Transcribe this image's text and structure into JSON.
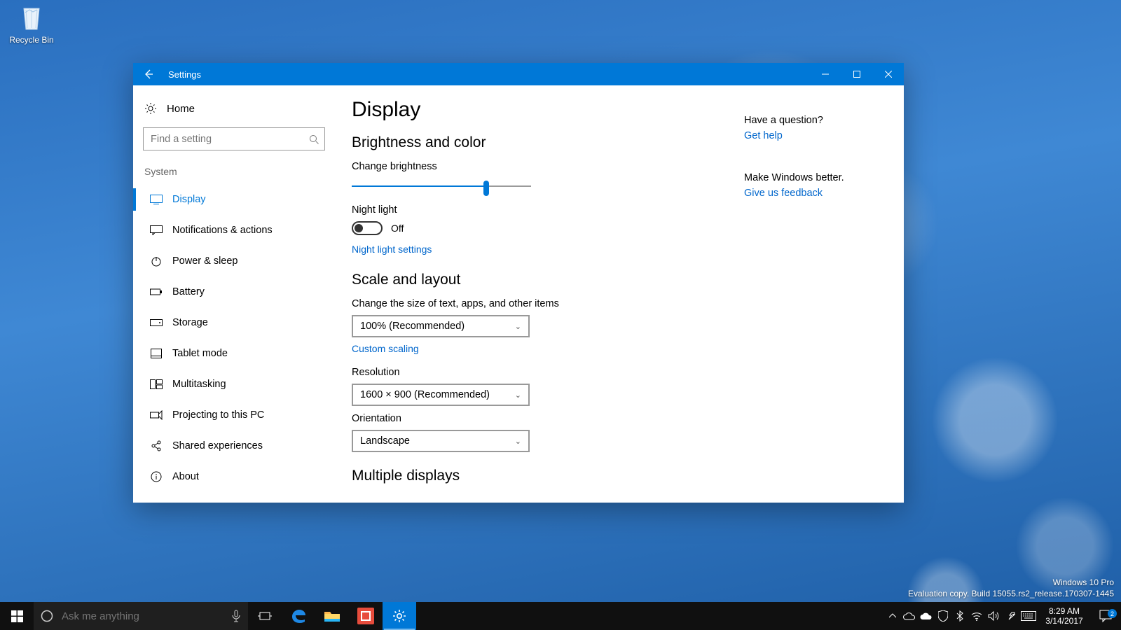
{
  "desktop": {
    "recycle_bin": "Recycle Bin",
    "watermark_line1": "Windows 10 Pro",
    "watermark_line2": "Evaluation copy. Build 15055.rs2_release.170307-1445"
  },
  "settings": {
    "title": "Settings",
    "home": "Home",
    "search_placeholder": "Find a setting",
    "group": "System",
    "nav": {
      "display": "Display",
      "notifications": "Notifications & actions",
      "power": "Power & sleep",
      "battery": "Battery",
      "storage": "Storage",
      "tablet": "Tablet mode",
      "multitask": "Multitasking",
      "projecting": "Projecting to this PC",
      "shared": "Shared experiences",
      "about": "About"
    },
    "page_title": "Display",
    "sect_brightness": "Brightness and color",
    "brightness_label": "Change brightness",
    "brightness_percent": 75,
    "night_light_label": "Night light",
    "night_light_state": "Off",
    "night_light_settings": "Night light settings",
    "sect_scale": "Scale and layout",
    "scale_label": "Change the size of text, apps, and other items",
    "scale_value": "100% (Recommended)",
    "custom_scaling": "Custom scaling",
    "resolution_label": "Resolution",
    "resolution_value": "1600 × 900 (Recommended)",
    "orientation_label": "Orientation",
    "orientation_value": "Landscape",
    "sect_multi": "Multiple displays",
    "help_q": "Have a question?",
    "help_link": "Get help",
    "feedback_q": "Make Windows better.",
    "feedback_link": "Give us feedback"
  },
  "taskbar": {
    "search_placeholder": "Ask me anything",
    "time": "8:29 AM",
    "date": "3/14/2017",
    "notif_count": "2"
  }
}
